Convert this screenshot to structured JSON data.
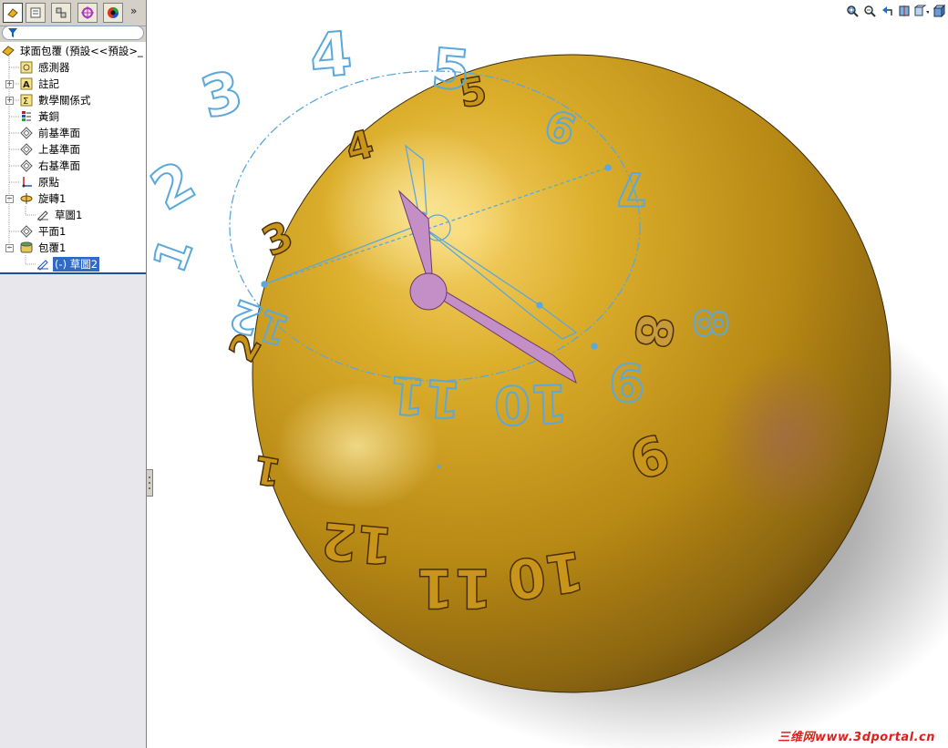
{
  "feature_manager": {
    "tabs": [
      {
        "name": "featuremanager-tab-icon",
        "active": true
      },
      {
        "name": "propertymanager-tab-icon",
        "active": false
      },
      {
        "name": "configurationmanager-tab-icon",
        "active": false
      },
      {
        "name": "dimxpert-tab-icon",
        "active": false
      },
      {
        "name": "appearance-tab-icon",
        "active": false
      }
    ],
    "more_label": "»",
    "filter_icon": "filter-funnel-icon",
    "tree": {
      "root": "球面包覆 (預設<<預設>_",
      "items": [
        {
          "label": "感測器",
          "icon": "sensor-icon"
        },
        {
          "label": "註記",
          "icon": "annotation-icon"
        },
        {
          "label": "數學關係式",
          "icon": "equation-icon"
        },
        {
          "label": "黃銅",
          "icon": "material-icon"
        },
        {
          "label": "前基準面",
          "icon": "plane-icon"
        },
        {
          "label": "上基準面",
          "icon": "plane-icon"
        },
        {
          "label": "右基準面",
          "icon": "plane-icon"
        },
        {
          "label": "原點",
          "icon": "origin-icon"
        },
        {
          "label": "旋轉1",
          "icon": "revolve-icon"
        },
        {
          "label": "草圖1",
          "icon": "sketch-icon"
        },
        {
          "label": "平面1",
          "icon": "plane-icon"
        },
        {
          "label": "包覆1",
          "icon": "wrap-icon"
        },
        {
          "label": "(-) 草圖2",
          "icon": "sketch-icon"
        }
      ]
    }
  },
  "view_toolbar": [
    "zoom-to-fit-icon",
    "zoom-to-area-icon",
    "previous-view-icon",
    "section-view-icon",
    "view-orientation-icon",
    "display-style-icon"
  ],
  "model": {
    "sphere_color": "#c89a1e",
    "sketch_color": "#5aa8dc",
    "hand_color": "#c38fc6",
    "sketch_numerals": [
      "1",
      "2",
      "3",
      "4",
      "5",
      "6",
      "7",
      "8",
      "9",
      "10",
      "11",
      "12"
    ],
    "embossed_numerals": [
      "1",
      "2",
      "3",
      "4",
      "5",
      "6",
      "7",
      "8",
      "9",
      "10",
      "11",
      "12"
    ]
  },
  "watermark": "三维网www.3dportal.cn"
}
